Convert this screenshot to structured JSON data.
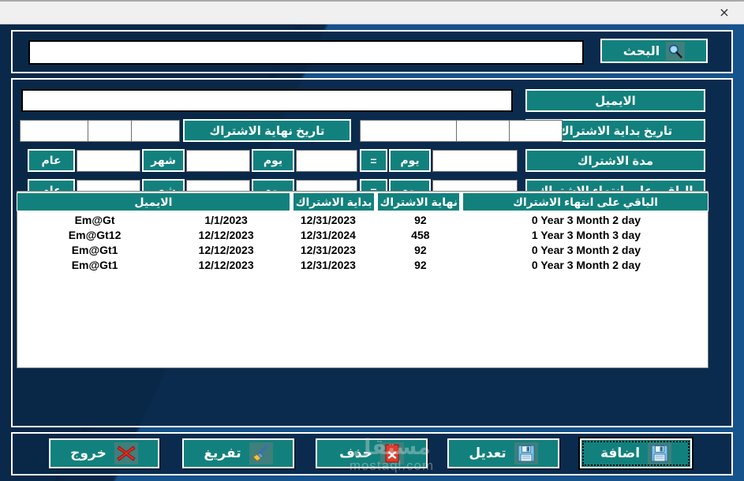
{
  "window": {
    "close_label": "×",
    "colors": {
      "bg_dark": "#0a2849",
      "bg_light": "#16528c",
      "accent_teal": "#12817d",
      "panel_border": "#ffffff",
      "field_bg": "#ffffff"
    }
  },
  "search": {
    "button_label": "البحث",
    "input_value": "",
    "input_placeholder": "",
    "icon": "search-icon"
  },
  "form": {
    "email": {
      "label": "الايميل",
      "value": ""
    },
    "start_date": {
      "label": "تاريخ بداية الاشتراك",
      "parts": [
        "",
        "",
        ""
      ]
    },
    "end_date": {
      "label": "تاريخ نهاية الاشتراك",
      "parts": [
        "",
        "",
        ""
      ]
    },
    "duration": {
      "label": "مدة الاشتراك",
      "total_days_value": "",
      "day_label": "يوم",
      "equals_label": "=",
      "days_value": "",
      "days_unit_label": "يوم",
      "months_value": "",
      "months_unit_label": "شهر",
      "years_value": "",
      "years_unit_label": "عام"
    },
    "remaining": {
      "label": "الباقي على انتهاء الاشتراك",
      "total_days_value": "",
      "day_label": "يوم",
      "equals_label": "=",
      "days_value": "",
      "days_unit_label": "يوم",
      "months_value": "",
      "months_unit_label": "شهر",
      "years_value": "",
      "years_unit_label": "عام"
    }
  },
  "table": {
    "columns": [
      {
        "key": "remaining",
        "label": "الباقي على انتهاء الاشتراك"
      },
      {
        "key": "end",
        "label": "نهاية الاشتراك"
      },
      {
        "key": "start",
        "label": "بداية الاشتراك"
      },
      {
        "key": "email",
        "label": "الايميل"
      }
    ],
    "rows": [
      {
        "remaining_text": "0 Year 3 Month 2 day",
        "remaining_days": "92",
        "end": "12/31/2023",
        "start": "1/1/2023",
        "email": "Em@Gt"
      },
      {
        "remaining_text": "1 Year 3 Month 3 day",
        "remaining_days": "458",
        "end": "12/31/2024",
        "start": "12/12/2023",
        "email": "Em@Gt12"
      },
      {
        "remaining_text": "0 Year 3 Month 2 day",
        "remaining_days": "92",
        "end": "12/31/2023",
        "start": "12/12/2023",
        "email": "Em@Gt1"
      },
      {
        "remaining_text": "0 Year 3 Month 2 day",
        "remaining_days": "92",
        "end": "12/31/2023",
        "start": "12/12/2023",
        "email": "Em@Gt1"
      }
    ]
  },
  "actions": [
    {
      "name": "exit",
      "label": "خروج",
      "icon": "red-x-icon",
      "focused": false
    },
    {
      "name": "clear",
      "label": "تفريغ",
      "icon": "broom-icon",
      "focused": false
    },
    {
      "name": "delete",
      "label": "حذف",
      "icon": "delete-x-icon",
      "focused": false
    },
    {
      "name": "edit",
      "label": "تعديل",
      "icon": "floppy-disk-icon",
      "focused": false
    },
    {
      "name": "add",
      "label": "اضافة",
      "icon": "floppy-disk-icon",
      "focused": true
    }
  ],
  "watermark": {
    "arabic": "مستقل",
    "latin": "mostaql.com"
  }
}
